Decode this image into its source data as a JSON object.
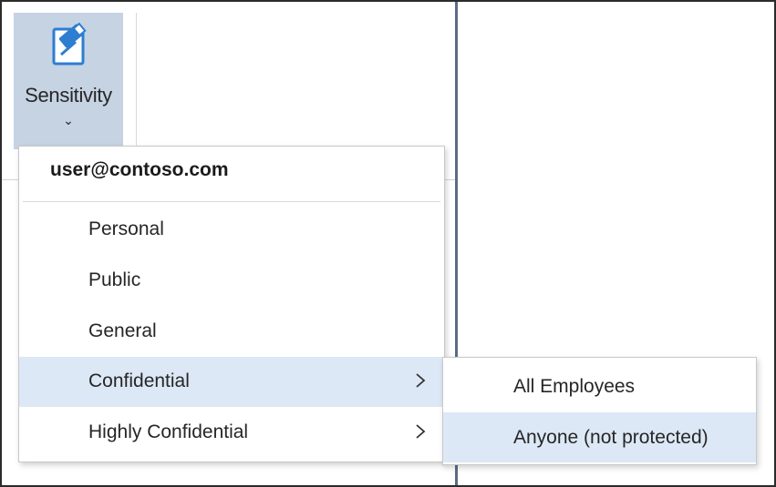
{
  "ribbon": {
    "sensitivity_label": "Sensitivity",
    "caret": "⌄",
    "icon": "sensitivity-tag-icon"
  },
  "menu": {
    "header": "user@contoso.com",
    "items": [
      {
        "label": "Personal",
        "has_submenu": false
      },
      {
        "label": "Public",
        "has_submenu": false
      },
      {
        "label": "General",
        "has_submenu": false
      },
      {
        "label": "Confidential",
        "has_submenu": true,
        "highlighted": true
      },
      {
        "label": "Highly Confidential",
        "has_submenu": true
      }
    ]
  },
  "submenu": {
    "items": [
      {
        "label": "All Employees"
      },
      {
        "label": "Anyone (not protected)",
        "highlighted": true
      }
    ]
  },
  "colors": {
    "highlight": "#dde8f6",
    "button_active": "#c5d3e3",
    "icon_blue": "#2e7dd1"
  }
}
